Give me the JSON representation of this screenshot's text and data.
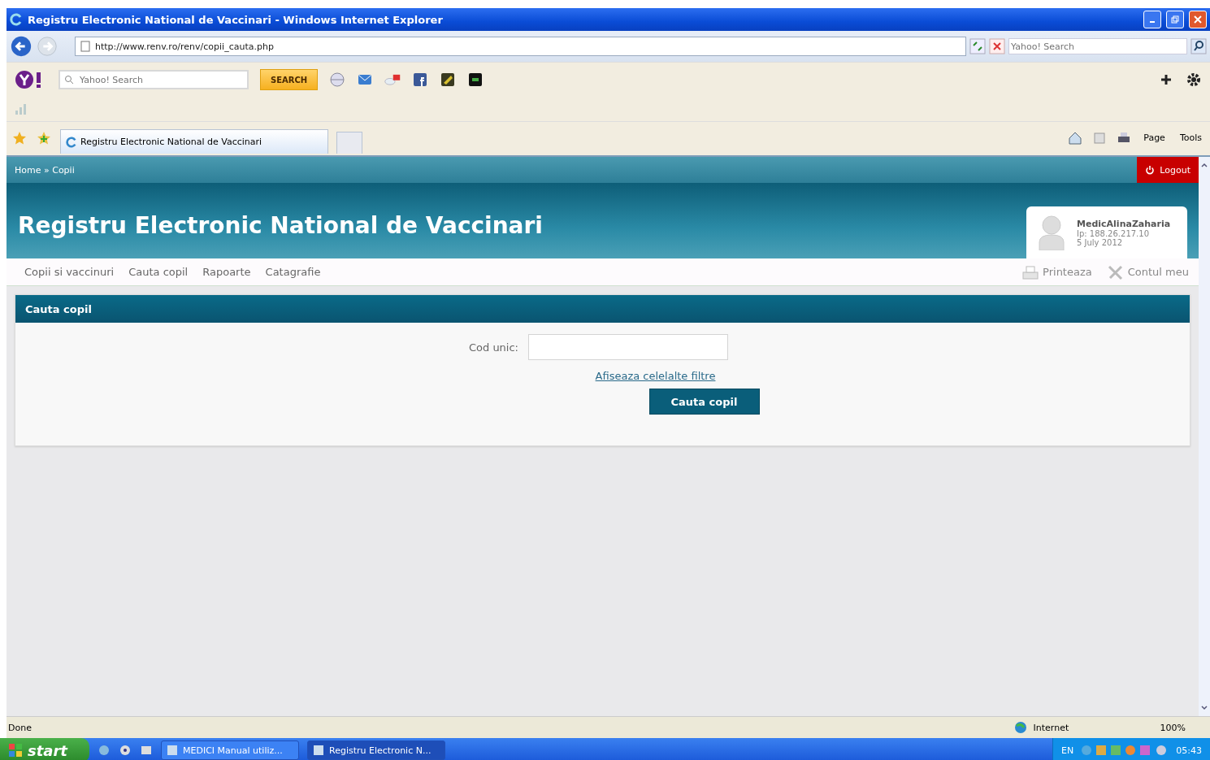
{
  "window": {
    "title": "Registru Electronic National de Vaccinari - Windows Internet Explorer"
  },
  "address_bar": {
    "url": "http://www.renv.ro/renv/copii_cauta.php",
    "search_placeholder": "Yahoo! Search"
  },
  "yahoo_toolbar": {
    "search_placeholder": "Yahoo! Search",
    "search_button": "SEARCH"
  },
  "tabs": [
    {
      "label": "Registru Electronic National de Vaccinari",
      "selected": true
    }
  ],
  "command_bar": {
    "items": [
      "Page",
      "Tools"
    ]
  },
  "page": {
    "breadcrumb": "Home » Copii",
    "logout": "Logout",
    "site_title": "Registru Electronic National de Vaccinari",
    "user": {
      "name": "MedicAlinaZaharia",
      "ip": "Ip: 188.26.217.10",
      "date": "5 July 2012"
    },
    "menu": [
      "Copii si vaccinuri",
      "Cauta copil",
      "Rapoarte",
      "Catagrafie"
    ],
    "actions": [
      {
        "kind": "print",
        "label": "Printeaza"
      },
      {
        "kind": "account",
        "label": "Contul meu"
      }
    ],
    "panel": {
      "title": "Cauta copil",
      "field_label": "Cod unic:",
      "link": "Afiseaza celelalte filtre",
      "button": "Cauta copil"
    }
  },
  "status_bar": {
    "text": "Done",
    "zone": "Internet",
    "zoom": "100%"
  },
  "taskbar": {
    "start": "start",
    "tasks": [
      {
        "label": "MEDICI Manual utiliz...",
        "selected": false
      },
      {
        "label": "Registru Electronic N...",
        "selected": true
      }
    ],
    "language": "EN",
    "clock": "05:43"
  }
}
